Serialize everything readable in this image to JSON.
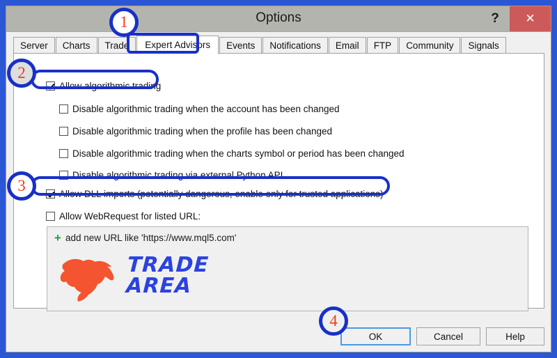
{
  "window": {
    "title": "Options",
    "help_button": "?",
    "close_button": "✕"
  },
  "tabs": [
    {
      "label": "Server",
      "active": false
    },
    {
      "label": "Charts",
      "active": false
    },
    {
      "label": "Trade",
      "active": false
    },
    {
      "label": "Expert Advisors",
      "active": true
    },
    {
      "label": "Events",
      "active": false
    },
    {
      "label": "Notifications",
      "active": false
    },
    {
      "label": "Email",
      "active": false
    },
    {
      "label": "FTP",
      "active": false
    },
    {
      "label": "Community",
      "active": false
    },
    {
      "label": "Signals",
      "active": false
    }
  ],
  "options": {
    "allow_algo_trading": {
      "label": "Allow algorithmic trading",
      "checked": true
    },
    "disable_on_account_change": {
      "label": "Disable algorithmic trading when the account has been changed",
      "checked": false
    },
    "disable_on_profile_change": {
      "label": "Disable algorithmic trading when the profile has been changed",
      "checked": false
    },
    "disable_on_symbol_change": {
      "label": "Disable algorithmic trading when the charts symbol or period has been changed",
      "checked": false
    },
    "disable_python_api": {
      "label": "Disable algorithmic trading via external Python API",
      "checked": false
    },
    "allow_dll_imports": {
      "label": "Allow DLL imports (potentially dangerous, enable only for trusted applications)",
      "checked": true
    },
    "allow_webrequest": {
      "label": "Allow WebRequest for listed URL:",
      "checked": false
    }
  },
  "url_list": {
    "add_icon": "+",
    "add_text": "add new URL like 'https://www.mql5.com'",
    "entries": []
  },
  "logo": {
    "line1": "TRADE",
    "line2": "AREA",
    "bull_color": "#f4542f",
    "text_color": "#2b42e0"
  },
  "buttons": {
    "ok": "OK",
    "cancel": "Cancel",
    "help": "Help"
  },
  "annotations": [
    {
      "id": "1",
      "target": "expert-advisors-tab"
    },
    {
      "id": "2",
      "target": "allow-algorithmic-trading-checkbox"
    },
    {
      "id": "3",
      "target": "allow-dll-imports-checkbox"
    },
    {
      "id": "4",
      "target": "ok-button"
    }
  ],
  "colors": {
    "frame_blue": "#2b56d4",
    "annotation_ring": "#1830c8",
    "annotation_number": "#f03b20",
    "close_red": "#cd5a5a",
    "titlebar_gray": "#b4b4ae",
    "plus_green": "#23a03c"
  }
}
